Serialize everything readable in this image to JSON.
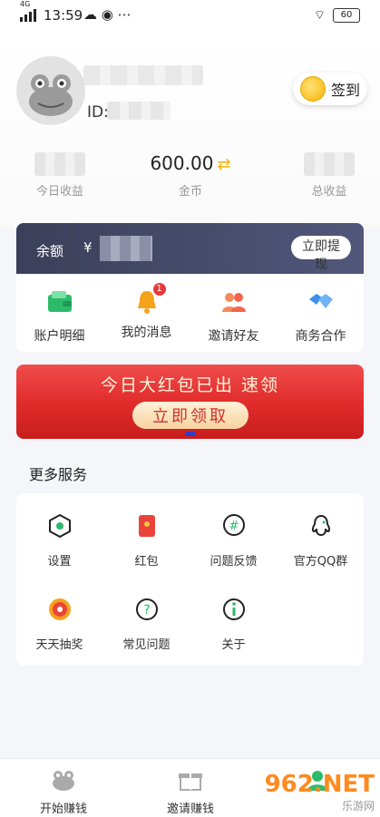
{
  "status": {
    "time": "13:59",
    "signal": "4G",
    "battery": "60"
  },
  "profile": {
    "id_label": "ID:",
    "signin_label": "签到"
  },
  "stats": [
    {
      "value": "",
      "label": "今日收益"
    },
    {
      "value": "600.00",
      "label": "金币"
    },
    {
      "value": "",
      "label": "总收益"
    }
  ],
  "balance": {
    "label": "余额",
    "currency": "¥",
    "withdraw_label": "立即提现"
  },
  "quick": [
    {
      "label": "账户明细",
      "icon": "wallet-icon"
    },
    {
      "label": "我的消息",
      "icon": "bell-icon",
      "badge": "1"
    },
    {
      "label": "邀请好友",
      "icon": "friends-icon"
    },
    {
      "label": "商务合作",
      "icon": "handshake-icon"
    }
  ],
  "banner": {
    "title": "今日大红包已出 速领",
    "cta": "立即领取"
  },
  "more": {
    "title": "更多服务",
    "items": [
      {
        "label": "设置",
        "icon": "settings-icon"
      },
      {
        "label": "红包",
        "icon": "red-envelope-icon"
      },
      {
        "label": "问题反馈",
        "icon": "feedback-icon"
      },
      {
        "label": "官方QQ群",
        "icon": "qq-icon"
      },
      {
        "label": "天天抽奖",
        "icon": "lottery-wheel-icon"
      },
      {
        "label": "常见问题",
        "icon": "faq-icon"
      },
      {
        "label": "关于",
        "icon": "info-icon"
      }
    ]
  },
  "tabbar": [
    {
      "label": "开始赚钱",
      "icon": "frog-icon"
    },
    {
      "label": "邀请赚钱",
      "icon": "gift-icon"
    },
    {
      "label": "",
      "icon": "profile-icon"
    }
  ],
  "watermark": {
    "text": "962.NET",
    "sub": "乐游网"
  },
  "colors": {
    "accent": "#e02a2a",
    "card_dark": "#3b3f59",
    "coin": "#f5b400",
    "badge": "#e53a3a"
  }
}
